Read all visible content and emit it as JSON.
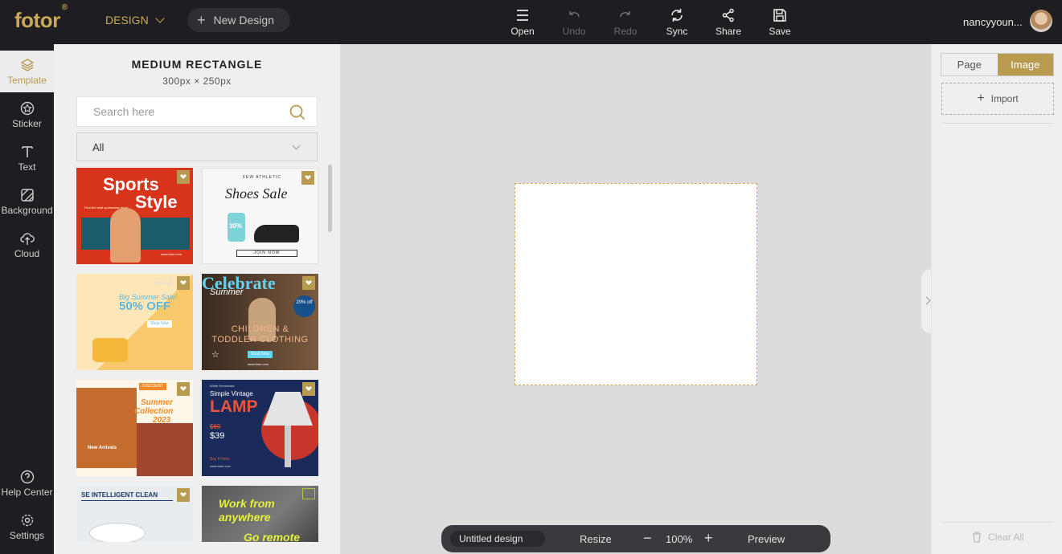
{
  "app": {
    "logo": "fotor",
    "logo_mark": "®",
    "design_menu": "DESIGN",
    "new_design": "New Design",
    "username": "nancyyoun...",
    "colors": {
      "accent": "#b89b4f",
      "topbar": "#1e1e22",
      "workspace": "#dcdcdc"
    }
  },
  "toolbar": {
    "open": "Open",
    "undo": "Undo",
    "redo": "Redo",
    "sync": "Sync",
    "share": "Share",
    "save": "Save"
  },
  "rail": {
    "template": "Template",
    "sticker": "Sticker",
    "text": "Text",
    "background": "Background",
    "cloud": "Cloud",
    "help": "Help Center",
    "settings": "Settings"
  },
  "panel": {
    "title": "MEDIUM RECTANGLE",
    "subtitle": "300px × 250px",
    "search_placeholder": "Search here",
    "filter_value": "All",
    "templates": [
      {
        "title": "Sports Style",
        "line1": "Sports",
        "line2": "Style",
        "caption": "Find the best sportswear here!",
        "url": "www.fotor.com"
      },
      {
        "title": "Shoes Sale",
        "brand": "FEW ATHLETIC",
        "headline": "Shoes Sale",
        "tag": "30%",
        "cta": "JOIN NOW"
      },
      {
        "title": "Big Summer Sale",
        "brand": "Deisnd",
        "line1": "Big Summer Sale!",
        "line2": "50% OFF",
        "cta": "Shop Now"
      },
      {
        "title": "Celebrate Summer",
        "line1": "Celebrate",
        "line2": "Summer",
        "line3": "CHILDREN &",
        "line4": "TODDLER CLOTHING",
        "badge": "20% off",
        "cta": "Shop Now",
        "url": "www.fotor.com"
      },
      {
        "title": "Summer Collection 2023",
        "badge": "DISCOUNT",
        "line1": "Summer",
        "line2": "Collection",
        "line3": "2023",
        "line4": "New Arrivals"
      },
      {
        "title": "Simple Vintage Lamp",
        "brand": "White Homeware",
        "line1": "Simple Vintage",
        "line2": "LAMP",
        "old_price": "$69",
        "price": "$39",
        "cta": "Buy It Now",
        "url": "www.fotor.com"
      },
      {
        "title": "Intelligent Clean",
        "line1": "SE INTELLIGENT CLEAN"
      },
      {
        "title": "Work from anywhere",
        "line1": "Work from",
        "line2": "anywhere",
        "line3": "Go remote"
      }
    ]
  },
  "bottom": {
    "document_name": "Untitled design",
    "resize": "Resize",
    "zoom": "100%",
    "preview": "Preview"
  },
  "right": {
    "tab_page": "Page",
    "tab_image": "Image",
    "import": "Import",
    "clear_all": "Clear All"
  }
}
